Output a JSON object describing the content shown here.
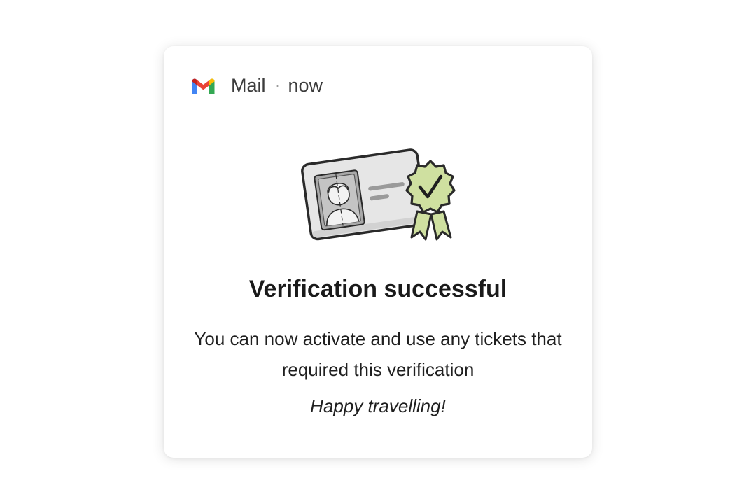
{
  "notification": {
    "app_name": "Mail",
    "separator": "·",
    "time": "now",
    "app_icon": "gmail-icon"
  },
  "content": {
    "illustration": "id-card-verified-badge",
    "title": "Verification successful",
    "body": "You can now activate and use any tickets that required this verification",
    "sign_off": "Happy travelling!"
  },
  "colors": {
    "badge_fill": "#cfe0a0",
    "card_fill": "#e8e8e8",
    "outline": "#2a2a2a",
    "gmail_red": "#ea4335",
    "gmail_blue": "#4285f4",
    "gmail_green": "#34a853",
    "gmail_yellow": "#fbbc04",
    "gmail_darkred": "#c5221f"
  }
}
